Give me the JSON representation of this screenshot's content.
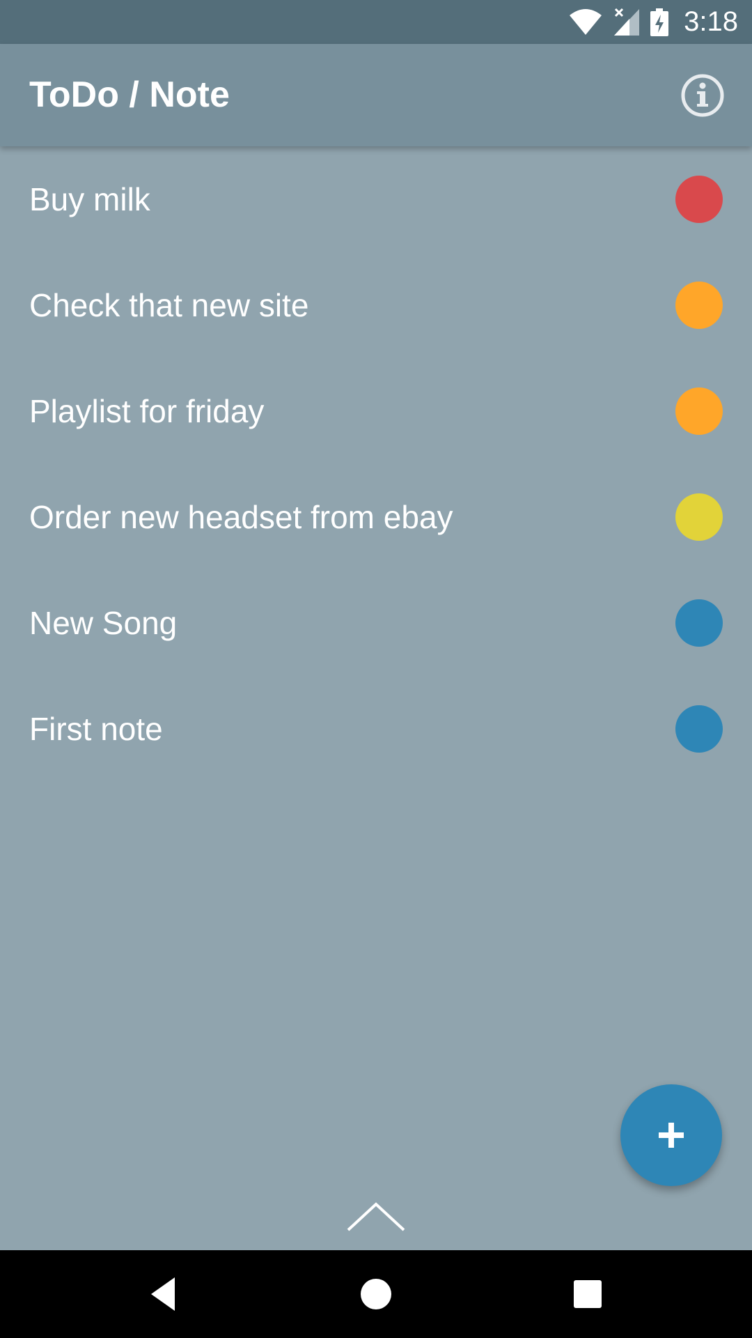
{
  "status_bar": {
    "time": "3:18",
    "icons": [
      "wifi-icon",
      "signal-icon",
      "battery-charging-icon"
    ]
  },
  "app_bar": {
    "title": "ToDo / Note",
    "action_icon": "info-icon"
  },
  "notes": [
    {
      "title": "Buy milk",
      "priority_color": "#d9494c"
    },
    {
      "title": "Check that new site",
      "priority_color": "#ffa629"
    },
    {
      "title": "Playlist for friday",
      "priority_color": "#ffa629"
    },
    {
      "title": "Order new headset from ebay",
      "priority_color": "#e2d339"
    },
    {
      "title": "New Song",
      "priority_color": "#2e86b6"
    },
    {
      "title": "First note",
      "priority_color": "#2e86b6"
    }
  ],
  "fab": {
    "icon": "plus-icon",
    "color": "#2e86b6"
  },
  "bottom_handle": {
    "icon": "chevron-up-icon"
  },
  "nav_bar": {
    "icons": [
      "back-icon",
      "home-icon",
      "recents-icon"
    ]
  },
  "colors": {
    "status_bar": "#546e7a",
    "app_bar": "#78909c",
    "background": "#90a4ae"
  }
}
